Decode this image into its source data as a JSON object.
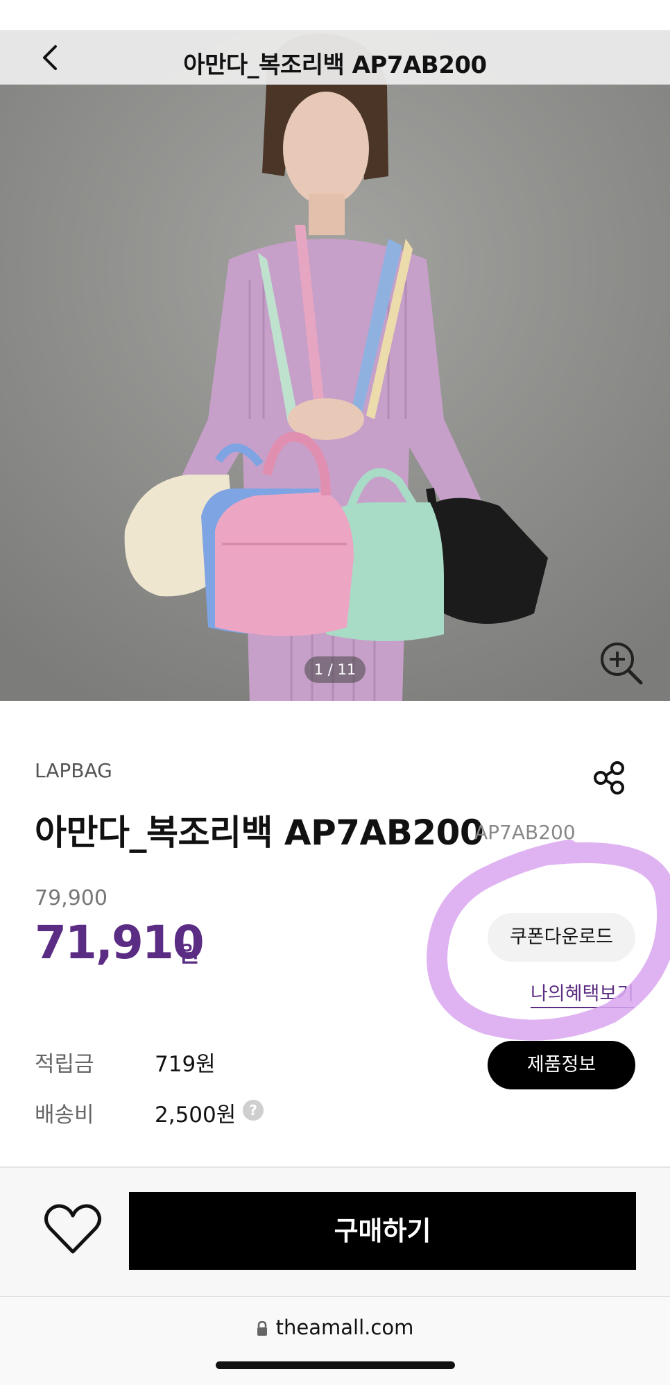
{
  "header": {
    "title": "아만다_복조리백 AP7AB200"
  },
  "gallery": {
    "counter": "1 / 11"
  },
  "product": {
    "brand": "LAPBAG",
    "name": "아만다_복조리백 AP7AB200",
    "code": "AP7AB200",
    "original_price": "79,900",
    "sale_price": "71,910",
    "currency": "원",
    "price_color": "#5b2c83"
  },
  "actions": {
    "coupon_label": "쿠폰다운로드",
    "benefit_label": "나의혜택보기",
    "product_info_label": "제품정보",
    "buy_label": "구매하기"
  },
  "details": [
    {
      "label": "적립금",
      "value": "719원"
    },
    {
      "label": "배송비",
      "value": "2,500원"
    }
  ],
  "help_mark": "?",
  "browser": {
    "url": "theamall.com"
  },
  "icons": [
    "chevron-left-icon",
    "zoom-in-icon",
    "share-icon",
    "help-icon",
    "heart-icon",
    "lock-icon"
  ],
  "annotation_color": "#d9a6f0"
}
